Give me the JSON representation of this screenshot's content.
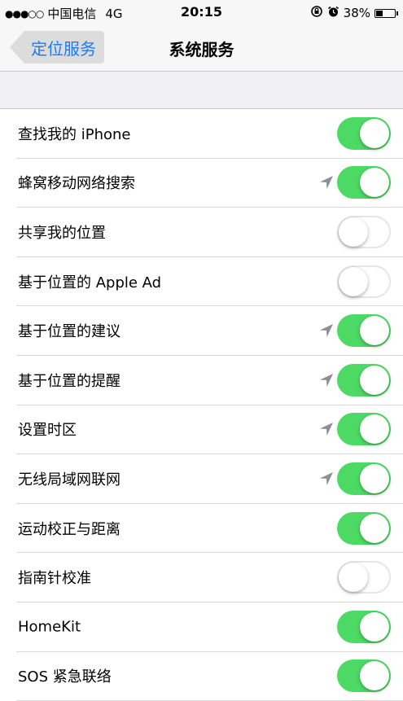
{
  "status_bar": {
    "signal": "●●●○○",
    "carrier": "中国电信",
    "network": "4G",
    "time": "20:15",
    "battery_percent": "38%",
    "battery_level": 0.38
  },
  "nav": {
    "back_label": "定位服务",
    "title": "系统服务"
  },
  "colors": {
    "accent": "#1a7cf5",
    "toggle_on": "#4cd964",
    "toggle_off_border": "#e5e5ea",
    "location_arrow": "#8e8e93"
  },
  "items": [
    {
      "label": "查找我的 iPhone",
      "enabled": true,
      "location_used": false
    },
    {
      "label": "蜂窝移动网络搜索",
      "enabled": true,
      "location_used": true
    },
    {
      "label": "共享我的位置",
      "enabled": false,
      "location_used": false
    },
    {
      "label": "基于位置的 Apple Ad",
      "enabled": false,
      "location_used": false
    },
    {
      "label": "基于位置的建议",
      "enabled": true,
      "location_used": true
    },
    {
      "label": "基于位置的提醒",
      "enabled": true,
      "location_used": true
    },
    {
      "label": "设置时区",
      "enabled": true,
      "location_used": true
    },
    {
      "label": "无线局域网联网",
      "enabled": true,
      "location_used": true
    },
    {
      "label": "运动校正与距离",
      "enabled": true,
      "location_used": false
    },
    {
      "label": "指南针校准",
      "enabled": false,
      "location_used": false
    },
    {
      "label": "HomeKit",
      "enabled": true,
      "location_used": false
    },
    {
      "label": "SOS 紧急联络",
      "enabled": true,
      "location_used": false
    }
  ]
}
